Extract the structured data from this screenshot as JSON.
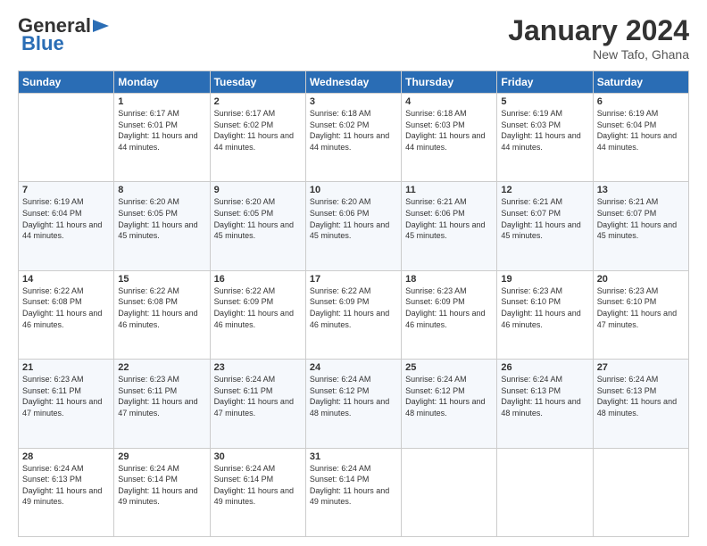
{
  "header": {
    "logo_line1": "General",
    "logo_line2": "Blue",
    "month_title": "January 2024",
    "location": "New Tafo, Ghana"
  },
  "days_of_week": [
    "Sunday",
    "Monday",
    "Tuesday",
    "Wednesday",
    "Thursday",
    "Friday",
    "Saturday"
  ],
  "weeks": [
    [
      {
        "day": "",
        "info": ""
      },
      {
        "day": "1",
        "info": "Sunrise: 6:17 AM\nSunset: 6:01 PM\nDaylight: 11 hours and 44 minutes."
      },
      {
        "day": "2",
        "info": "Sunrise: 6:17 AM\nSunset: 6:02 PM\nDaylight: 11 hours and 44 minutes."
      },
      {
        "day": "3",
        "info": "Sunrise: 6:18 AM\nSunset: 6:02 PM\nDaylight: 11 hours and 44 minutes."
      },
      {
        "day": "4",
        "info": "Sunrise: 6:18 AM\nSunset: 6:03 PM\nDaylight: 11 hours and 44 minutes."
      },
      {
        "day": "5",
        "info": "Sunrise: 6:19 AM\nSunset: 6:03 PM\nDaylight: 11 hours and 44 minutes."
      },
      {
        "day": "6",
        "info": "Sunrise: 6:19 AM\nSunset: 6:04 PM\nDaylight: 11 hours and 44 minutes."
      }
    ],
    [
      {
        "day": "7",
        "info": "Sunrise: 6:19 AM\nSunset: 6:04 PM\nDaylight: 11 hours and 44 minutes."
      },
      {
        "day": "8",
        "info": "Sunrise: 6:20 AM\nSunset: 6:05 PM\nDaylight: 11 hours and 45 minutes."
      },
      {
        "day": "9",
        "info": "Sunrise: 6:20 AM\nSunset: 6:05 PM\nDaylight: 11 hours and 45 minutes."
      },
      {
        "day": "10",
        "info": "Sunrise: 6:20 AM\nSunset: 6:06 PM\nDaylight: 11 hours and 45 minutes."
      },
      {
        "day": "11",
        "info": "Sunrise: 6:21 AM\nSunset: 6:06 PM\nDaylight: 11 hours and 45 minutes."
      },
      {
        "day": "12",
        "info": "Sunrise: 6:21 AM\nSunset: 6:07 PM\nDaylight: 11 hours and 45 minutes."
      },
      {
        "day": "13",
        "info": "Sunrise: 6:21 AM\nSunset: 6:07 PM\nDaylight: 11 hours and 45 minutes."
      }
    ],
    [
      {
        "day": "14",
        "info": "Sunrise: 6:22 AM\nSunset: 6:08 PM\nDaylight: 11 hours and 46 minutes."
      },
      {
        "day": "15",
        "info": "Sunrise: 6:22 AM\nSunset: 6:08 PM\nDaylight: 11 hours and 46 minutes."
      },
      {
        "day": "16",
        "info": "Sunrise: 6:22 AM\nSunset: 6:09 PM\nDaylight: 11 hours and 46 minutes."
      },
      {
        "day": "17",
        "info": "Sunrise: 6:22 AM\nSunset: 6:09 PM\nDaylight: 11 hours and 46 minutes."
      },
      {
        "day": "18",
        "info": "Sunrise: 6:23 AM\nSunset: 6:09 PM\nDaylight: 11 hours and 46 minutes."
      },
      {
        "day": "19",
        "info": "Sunrise: 6:23 AM\nSunset: 6:10 PM\nDaylight: 11 hours and 46 minutes."
      },
      {
        "day": "20",
        "info": "Sunrise: 6:23 AM\nSunset: 6:10 PM\nDaylight: 11 hours and 47 minutes."
      }
    ],
    [
      {
        "day": "21",
        "info": "Sunrise: 6:23 AM\nSunset: 6:11 PM\nDaylight: 11 hours and 47 minutes."
      },
      {
        "day": "22",
        "info": "Sunrise: 6:23 AM\nSunset: 6:11 PM\nDaylight: 11 hours and 47 minutes."
      },
      {
        "day": "23",
        "info": "Sunrise: 6:24 AM\nSunset: 6:11 PM\nDaylight: 11 hours and 47 minutes."
      },
      {
        "day": "24",
        "info": "Sunrise: 6:24 AM\nSunset: 6:12 PM\nDaylight: 11 hours and 48 minutes."
      },
      {
        "day": "25",
        "info": "Sunrise: 6:24 AM\nSunset: 6:12 PM\nDaylight: 11 hours and 48 minutes."
      },
      {
        "day": "26",
        "info": "Sunrise: 6:24 AM\nSunset: 6:13 PM\nDaylight: 11 hours and 48 minutes."
      },
      {
        "day": "27",
        "info": "Sunrise: 6:24 AM\nSunset: 6:13 PM\nDaylight: 11 hours and 48 minutes."
      }
    ],
    [
      {
        "day": "28",
        "info": "Sunrise: 6:24 AM\nSunset: 6:13 PM\nDaylight: 11 hours and 49 minutes."
      },
      {
        "day": "29",
        "info": "Sunrise: 6:24 AM\nSunset: 6:14 PM\nDaylight: 11 hours and 49 minutes."
      },
      {
        "day": "30",
        "info": "Sunrise: 6:24 AM\nSunset: 6:14 PM\nDaylight: 11 hours and 49 minutes."
      },
      {
        "day": "31",
        "info": "Sunrise: 6:24 AM\nSunset: 6:14 PM\nDaylight: 11 hours and 49 minutes."
      },
      {
        "day": "",
        "info": ""
      },
      {
        "day": "",
        "info": ""
      },
      {
        "day": "",
        "info": ""
      }
    ]
  ]
}
